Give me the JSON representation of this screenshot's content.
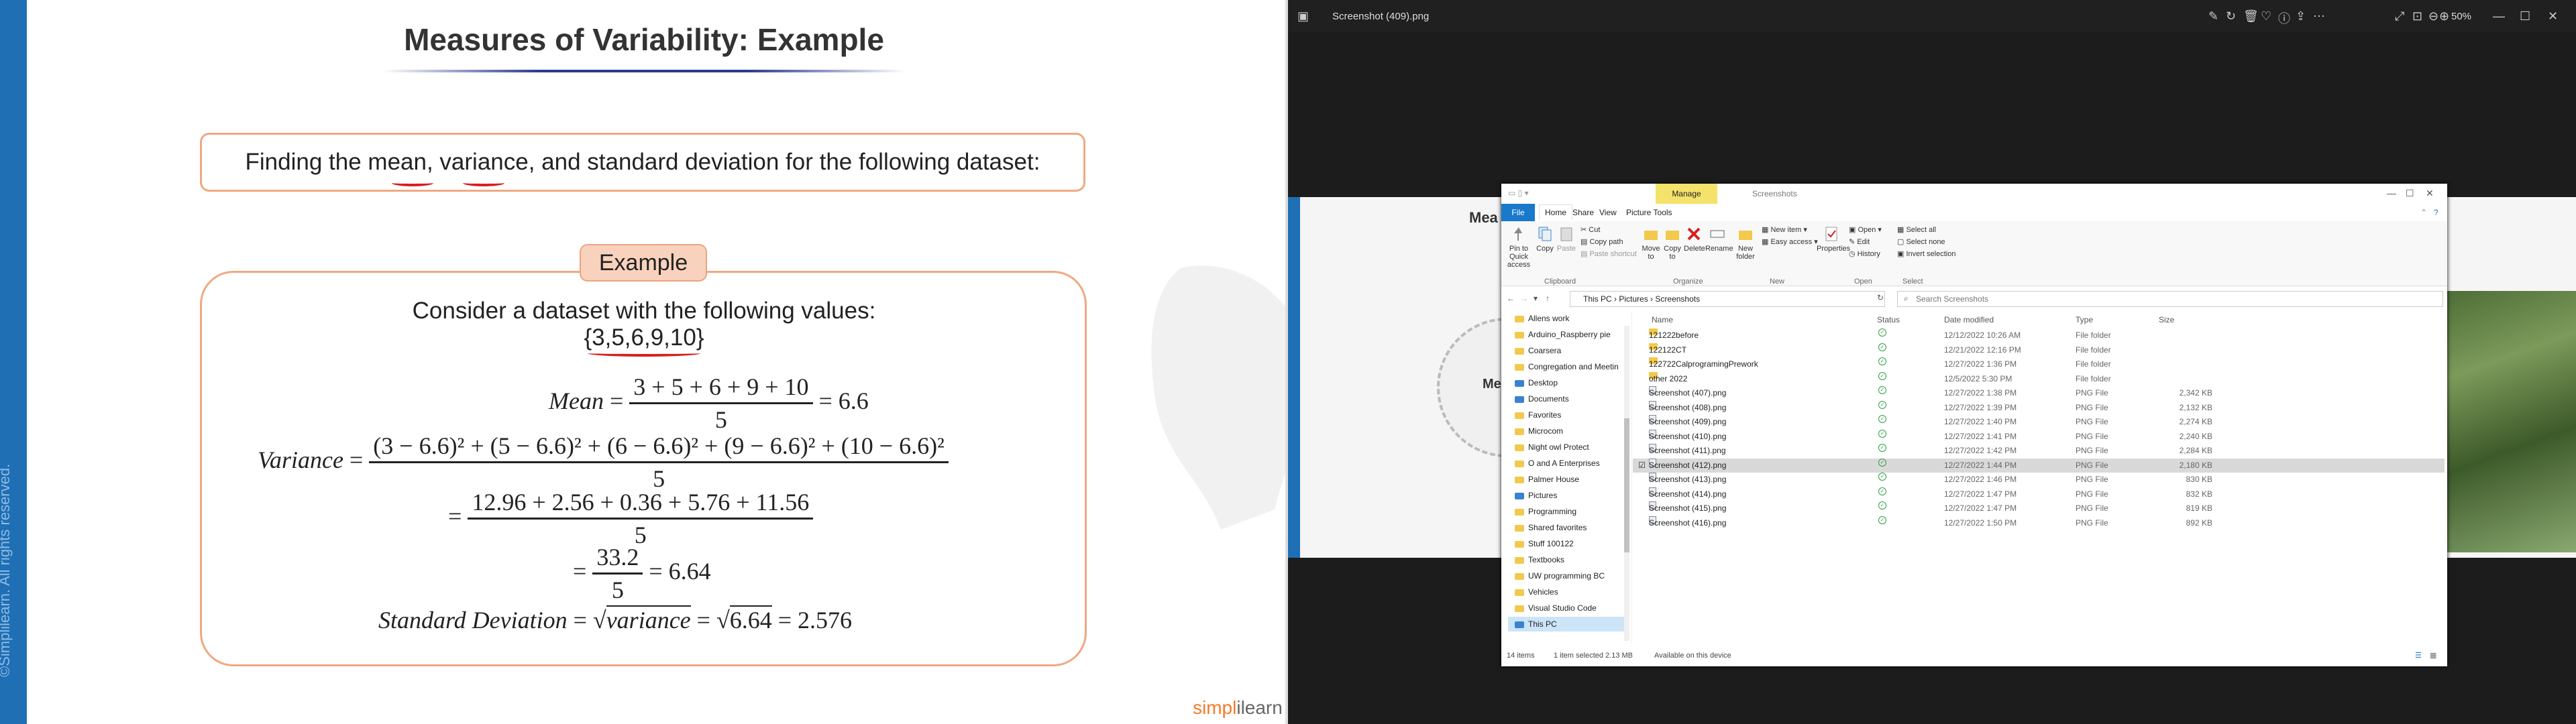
{
  "slide": {
    "title": "Measures of Variability: Example",
    "question": "Finding the mean, variance, and standard deviation for the following dataset:",
    "example_badge": "Example",
    "consider": "Consider a dataset with the following values:",
    "dataset": "{3,5,6,9,10}",
    "mean_label": "Mean",
    "mean_num": "3 + 5 + 6 + 9 + 10",
    "mean_den": "5",
    "mean_result": "= 6.6",
    "var_label": "Variance",
    "var_num": "(3 − 6.6)² + (5 − 6.6)² + (6 − 6.6)² + (9 − 6.6)² + (10 − 6.6)²",
    "var_den": "5",
    "var_num2": "12.96 + 2.56 + 0.36 + 5.76 + 11.56",
    "var_den2": "5",
    "var_num3": "33.2",
    "var_den3": "5",
    "var_result": "= 6.64",
    "sd_label": "Standard Deviation",
    "sd_mid": "variance",
    "sd_val": "6.64",
    "sd_result": "= 2.576",
    "watermark": "©Simplilearn. All rights reserved.",
    "brand_a": "simpl",
    "brand_b": "ilearn"
  },
  "viewer": {
    "filename": "Screenshot (409).png",
    "zoom": "50%",
    "bg_title": "Mea",
    "bg_circle": "Me"
  },
  "explorer": {
    "manage": "Manage",
    "window_title": "Screenshots",
    "tabs": [
      "File",
      "Home",
      "Share",
      "View",
      "Picture Tools"
    ],
    "ribbon": {
      "pin": "Pin to Quick access",
      "copy": "Copy",
      "paste": "Paste",
      "cut": "Cut",
      "copy_path": "Copy path",
      "paste_shortcut": "Paste shortcut",
      "move_to": "Move to",
      "copy_to": "Copy to",
      "delete": "Delete",
      "rename": "Rename",
      "new_folder": "New folder",
      "new_item": "New item",
      "easy_access": "Easy access",
      "properties": "Properties",
      "open": "Open",
      "edit": "Edit",
      "history": "History",
      "select_all": "Select all",
      "select_none": "Select none",
      "invert_selection": "Invert selection",
      "groups": [
        "Clipboard",
        "Organize",
        "New",
        "Open",
        "Select"
      ]
    },
    "path": [
      "This PC",
      "Pictures",
      "Screenshots"
    ],
    "search_placeholder": "Search Screenshots",
    "nav": [
      "Allens work",
      "Arduino_Raspberry pie",
      "Coarsera",
      "Congregation and Meetin",
      "Desktop",
      "Documents",
      "Favorites",
      "Microcom",
      "Night owl Protect",
      "O and A Enterprises",
      "Palmer House",
      "Pictures",
      "Programming",
      "Shared favorites",
      "Stuff 100122",
      "Textbooks",
      "UW programming BC",
      "Vehicles",
      "Visual Studio Code",
      "This PC"
    ],
    "columns": {
      "name": "Name",
      "status": "Status",
      "date": "Date modified",
      "type": "Type",
      "size": "Size"
    },
    "files": [
      {
        "name": "121222before",
        "date": "12/12/2022 10:26 AM",
        "type": "File folder",
        "size": ""
      },
      {
        "name": "122122CT",
        "date": "12/21/2022 12:16 PM",
        "type": "File folder",
        "size": ""
      },
      {
        "name": "122722CalprogramingPrework",
        "date": "12/27/2022 1:36 PM",
        "type": "File folder",
        "size": ""
      },
      {
        "name": "other 2022",
        "date": "12/5/2022 5:30 PM",
        "type": "File folder",
        "size": ""
      },
      {
        "name": "Screenshot (407).png",
        "date": "12/27/2022 1:38 PM",
        "type": "PNG File",
        "size": "2,342 KB"
      },
      {
        "name": "Screenshot (408).png",
        "date": "12/27/2022 1:39 PM",
        "type": "PNG File",
        "size": "2,132 KB"
      },
      {
        "name": "Screenshot (409).png",
        "date": "12/27/2022 1:40 PM",
        "type": "PNG File",
        "size": "2,274 KB"
      },
      {
        "name": "Screenshot (410).png",
        "date": "12/27/2022 1:41 PM",
        "type": "PNG File",
        "size": "2,240 KB"
      },
      {
        "name": "Screenshot (411).png",
        "date": "12/27/2022 1:42 PM",
        "type": "PNG File",
        "size": "2,284 KB"
      },
      {
        "name": "Screenshot (412).png",
        "date": "12/27/2022 1:44 PM",
        "type": "PNG File",
        "size": "2,180 KB"
      },
      {
        "name": "Screenshot (413).png",
        "date": "12/27/2022 1:46 PM",
        "type": "PNG File",
        "size": "830 KB"
      },
      {
        "name": "Screenshot (414).png",
        "date": "12/27/2022 1:47 PM",
        "type": "PNG File",
        "size": "832 KB"
      },
      {
        "name": "Screenshot (415).png",
        "date": "12/27/2022 1:47 PM",
        "type": "PNG File",
        "size": "819 KB"
      },
      {
        "name": "Screenshot (416).png",
        "date": "12/27/2022 1:50 PM",
        "type": "PNG File",
        "size": "892 KB"
      }
    ],
    "status": {
      "items": "14 items",
      "selected": "1 item selected  2.13 MB",
      "available": "Available on this device"
    },
    "colors": {
      "accent": "#1979ca",
      "manage": "#f4e26b",
      "folder": "#f2c94c"
    }
  }
}
